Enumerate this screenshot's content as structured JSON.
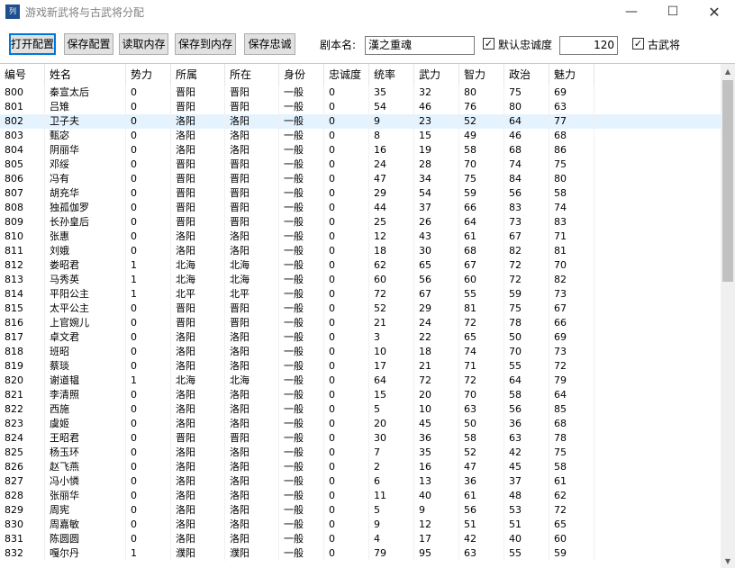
{
  "window": {
    "title": "游戏新武将与古武将分配",
    "icon_text": "列",
    "minimize": "—",
    "maximize": "☐",
    "close": "✕"
  },
  "toolbar": {
    "open_config": "打开配置",
    "save_config": "保存配置",
    "read_memory": "读取内存",
    "save_to_memory": "保存到内存",
    "save_loyalty": "保存忠诚",
    "script_name_label": "剧本名:",
    "script_name_value": "漢之重魂",
    "default_loyalty_label": "默认忠诚度",
    "default_loyalty_checked": true,
    "default_loyalty_value": "120",
    "ancient_general_label": "古武将",
    "ancient_general_checked": true
  },
  "table": {
    "columns": [
      "编号",
      "姓名",
      "势力",
      "所属",
      "所在",
      "身份",
      "忠诚度",
      "统率",
      "武力",
      "智力",
      "政治",
      "魅力"
    ],
    "selected_row": 2,
    "rows": [
      [
        "800",
        "秦宣太后",
        "0",
        "晋阳",
        "晋阳",
        "一般",
        "0",
        "35",
        "32",
        "80",
        "75",
        "69"
      ],
      [
        "801",
        "吕雉",
        "0",
        "晋阳",
        "晋阳",
        "一般",
        "0",
        "54",
        "46",
        "76",
        "80",
        "63"
      ],
      [
        "802",
        "卫子夫",
        "0",
        "洛阳",
        "洛阳",
        "一般",
        "0",
        "9",
        "23",
        "52",
        "64",
        "77"
      ],
      [
        "803",
        "甄宓",
        "0",
        "洛阳",
        "洛阳",
        "一般",
        "0",
        "8",
        "15",
        "49",
        "46",
        "68"
      ],
      [
        "804",
        "阴丽华",
        "0",
        "洛阳",
        "洛阳",
        "一般",
        "0",
        "16",
        "19",
        "58",
        "68",
        "86"
      ],
      [
        "805",
        "邓绥",
        "0",
        "晋阳",
        "晋阳",
        "一般",
        "0",
        "24",
        "28",
        "70",
        "74",
        "75"
      ],
      [
        "806",
        "冯有",
        "0",
        "晋阳",
        "晋阳",
        "一般",
        "0",
        "47",
        "34",
        "75",
        "84",
        "80"
      ],
      [
        "807",
        "胡充华",
        "0",
        "晋阳",
        "晋阳",
        "一般",
        "0",
        "29",
        "54",
        "59",
        "56",
        "58"
      ],
      [
        "808",
        "独孤伽罗",
        "0",
        "晋阳",
        "晋阳",
        "一般",
        "0",
        "44",
        "37",
        "66",
        "83",
        "74"
      ],
      [
        "809",
        "长孙皇后",
        "0",
        "晋阳",
        "晋阳",
        "一般",
        "0",
        "25",
        "26",
        "64",
        "73",
        "83"
      ],
      [
        "810",
        "张惠",
        "0",
        "洛阳",
        "洛阳",
        "一般",
        "0",
        "12",
        "43",
        "61",
        "67",
        "71"
      ],
      [
        "811",
        "刘娥",
        "0",
        "洛阳",
        "洛阳",
        "一般",
        "0",
        "18",
        "30",
        "68",
        "82",
        "81"
      ],
      [
        "812",
        "娄昭君",
        "1",
        "北海",
        "北海",
        "一般",
        "0",
        "62",
        "65",
        "67",
        "72",
        "70"
      ],
      [
        "813",
        "马秀英",
        "1",
        "北海",
        "北海",
        "一般",
        "0",
        "60",
        "56",
        "60",
        "72",
        "82"
      ],
      [
        "814",
        "平阳公主",
        "1",
        "北平",
        "北平",
        "一般",
        "0",
        "72",
        "67",
        "55",
        "59",
        "73"
      ],
      [
        "815",
        "太平公主",
        "0",
        "晋阳",
        "晋阳",
        "一般",
        "0",
        "52",
        "29",
        "81",
        "75",
        "67"
      ],
      [
        "816",
        "上官婉儿",
        "0",
        "晋阳",
        "晋阳",
        "一般",
        "0",
        "21",
        "24",
        "72",
        "78",
        "66"
      ],
      [
        "817",
        "卓文君",
        "0",
        "洛阳",
        "洛阳",
        "一般",
        "0",
        "3",
        "22",
        "65",
        "50",
        "69"
      ],
      [
        "818",
        "班昭",
        "0",
        "洛阳",
        "洛阳",
        "一般",
        "0",
        "10",
        "18",
        "74",
        "70",
        "73"
      ],
      [
        "819",
        "蔡琰",
        "0",
        "洛阳",
        "洛阳",
        "一般",
        "0",
        "17",
        "21",
        "71",
        "55",
        "72"
      ],
      [
        "820",
        "谢道韫",
        "1",
        "北海",
        "北海",
        "一般",
        "0",
        "64",
        "72",
        "72",
        "64",
        "79"
      ],
      [
        "821",
        "李清照",
        "0",
        "洛阳",
        "洛阳",
        "一般",
        "0",
        "15",
        "20",
        "70",
        "58",
        "64"
      ],
      [
        "822",
        "西施",
        "0",
        "洛阳",
        "洛阳",
        "一般",
        "0",
        "5",
        "10",
        "63",
        "56",
        "85"
      ],
      [
        "823",
        "虞姬",
        "0",
        "洛阳",
        "洛阳",
        "一般",
        "0",
        "20",
        "45",
        "50",
        "36",
        "68"
      ],
      [
        "824",
        "王昭君",
        "0",
        "晋阳",
        "晋阳",
        "一般",
        "0",
        "30",
        "36",
        "58",
        "63",
        "78"
      ],
      [
        "825",
        "杨玉环",
        "0",
        "洛阳",
        "洛阳",
        "一般",
        "0",
        "7",
        "35",
        "52",
        "42",
        "75"
      ],
      [
        "826",
        "赵飞燕",
        "0",
        "洛阳",
        "洛阳",
        "一般",
        "0",
        "2",
        "16",
        "47",
        "45",
        "58"
      ],
      [
        "827",
        "冯小憐",
        "0",
        "洛阳",
        "洛阳",
        "一般",
        "0",
        "6",
        "13",
        "36",
        "37",
        "61"
      ],
      [
        "828",
        "张丽华",
        "0",
        "洛阳",
        "洛阳",
        "一般",
        "0",
        "11",
        "40",
        "61",
        "48",
        "62"
      ],
      [
        "829",
        "周宪",
        "0",
        "洛阳",
        "洛阳",
        "一般",
        "0",
        "5",
        "9",
        "56",
        "53",
        "72"
      ],
      [
        "830",
        "周嘉敏",
        "0",
        "洛阳",
        "洛阳",
        "一般",
        "0",
        "9",
        "12",
        "51",
        "51",
        "65"
      ],
      [
        "831",
        "陈圆圆",
        "0",
        "洛阳",
        "洛阳",
        "一般",
        "0",
        "4",
        "17",
        "42",
        "40",
        "60"
      ],
      [
        "832",
        "嘎尔丹",
        "1",
        "濮阳",
        "濮阳",
        "一般",
        "0",
        "79",
        "95",
        "63",
        "55",
        "59"
      ]
    ]
  },
  "scrollbar": {
    "up_arrow": "▲",
    "down_arrow": "▼"
  }
}
